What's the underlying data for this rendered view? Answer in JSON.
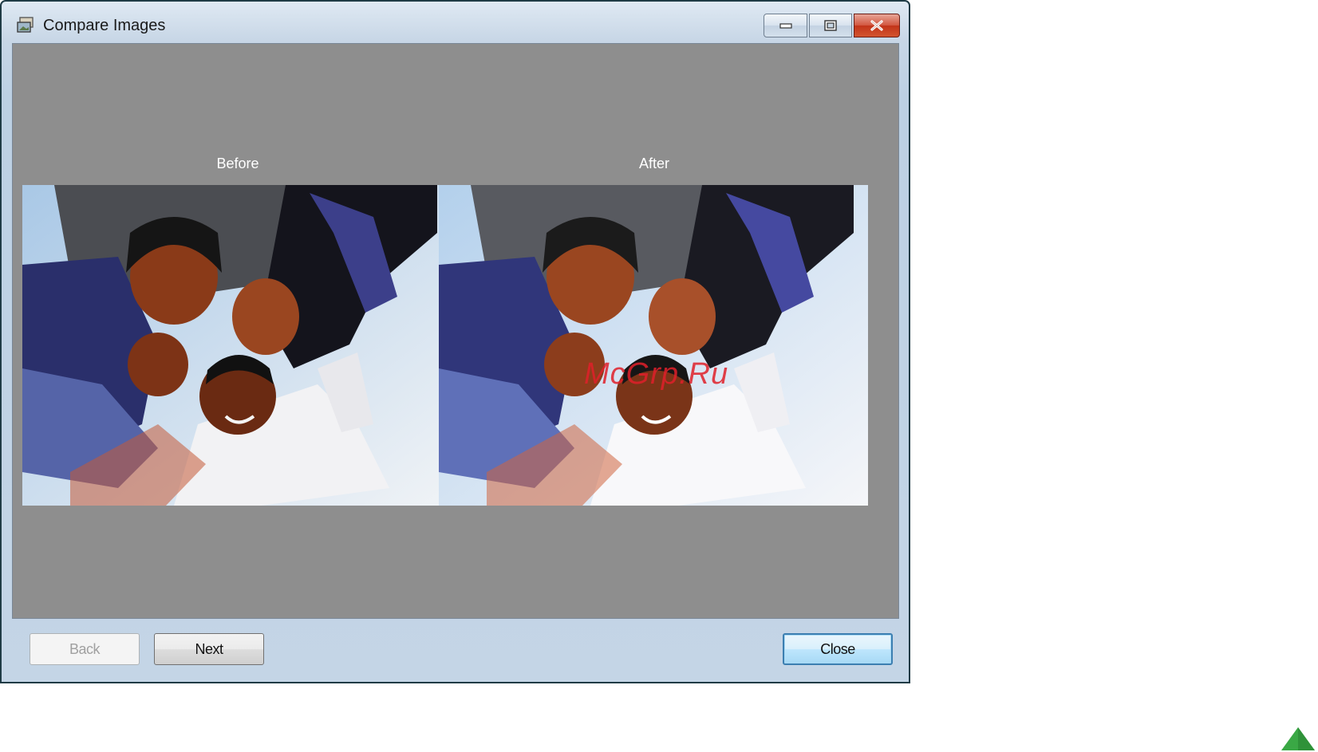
{
  "window": {
    "title": "Compare Images",
    "icons": {
      "app": "compare-images-app-icon",
      "minimize": "minimize-icon",
      "maximize": "maximize-icon",
      "close": "close-icon"
    }
  },
  "compare": {
    "before_label": "Before",
    "after_label": "After"
  },
  "footer": {
    "back_label": "Back",
    "next_label": "Next",
    "close_label": "Close",
    "back_enabled": false
  },
  "watermark": "McGrp.Ru",
  "page": {
    "scroll_top_icon": "triangle-up-icon",
    "scroll_top_color": "#3aa845"
  }
}
